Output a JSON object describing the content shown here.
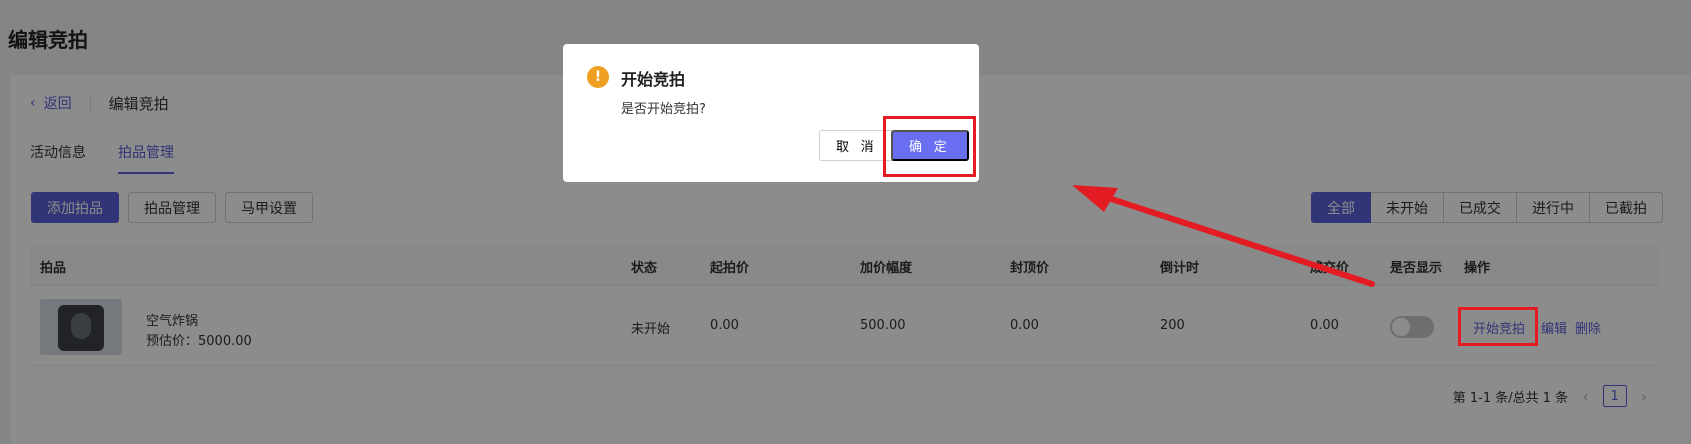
{
  "page": {
    "title": "编辑竞拍"
  },
  "topbar": {
    "back_label": "返回",
    "back_icon": "chevron-left-icon",
    "breadcrumb": "编辑竞拍"
  },
  "tabs": [
    {
      "label": "活动信息",
      "active": false
    },
    {
      "label": "拍品管理",
      "active": true
    }
  ],
  "toolbar": {
    "add_label": "添加拍品",
    "manage_label": "拍品管理",
    "vest_label": "马甲设置"
  },
  "filters": [
    {
      "label": "全部",
      "active": true
    },
    {
      "label": "未开始",
      "active": false
    },
    {
      "label": "已成交",
      "active": false
    },
    {
      "label": "进行中",
      "active": false
    },
    {
      "label": "已截拍",
      "active": false
    }
  ],
  "table": {
    "headers": {
      "item": "拍品",
      "status": "状态",
      "start_price": "起拍价",
      "increment": "加价幅度",
      "cap_price": "封顶价",
      "countdown": "倒计时",
      "deal_price": "成交价",
      "display": "是否显示",
      "ops": "操作"
    },
    "rows": [
      {
        "name": "空气炸锅",
        "estimate": "预估价：5000.00",
        "status": "未开始",
        "start_price": "0.00",
        "increment": "500.00",
        "cap_price": "0.00",
        "countdown": "200",
        "deal_price": "0.00",
        "display_on": false,
        "op_start": "开始竞拍",
        "op_edit": "编辑",
        "op_delete": "删除"
      }
    ]
  },
  "pagination": {
    "summary": "第 1-1 条/总共 1 条",
    "current": "1",
    "prev_icon": "chevron-left-icon",
    "next_icon": "chevron-right-icon"
  },
  "dialog": {
    "title": "开始竞拍",
    "content": "是否开始竞拍?",
    "cancel_label": "取 消",
    "ok_label": "确 定",
    "icon": "warning-icon"
  },
  "colors": {
    "accent": "#5a5fd8",
    "warning": "#f0a020",
    "highlight": "#e31b23"
  }
}
